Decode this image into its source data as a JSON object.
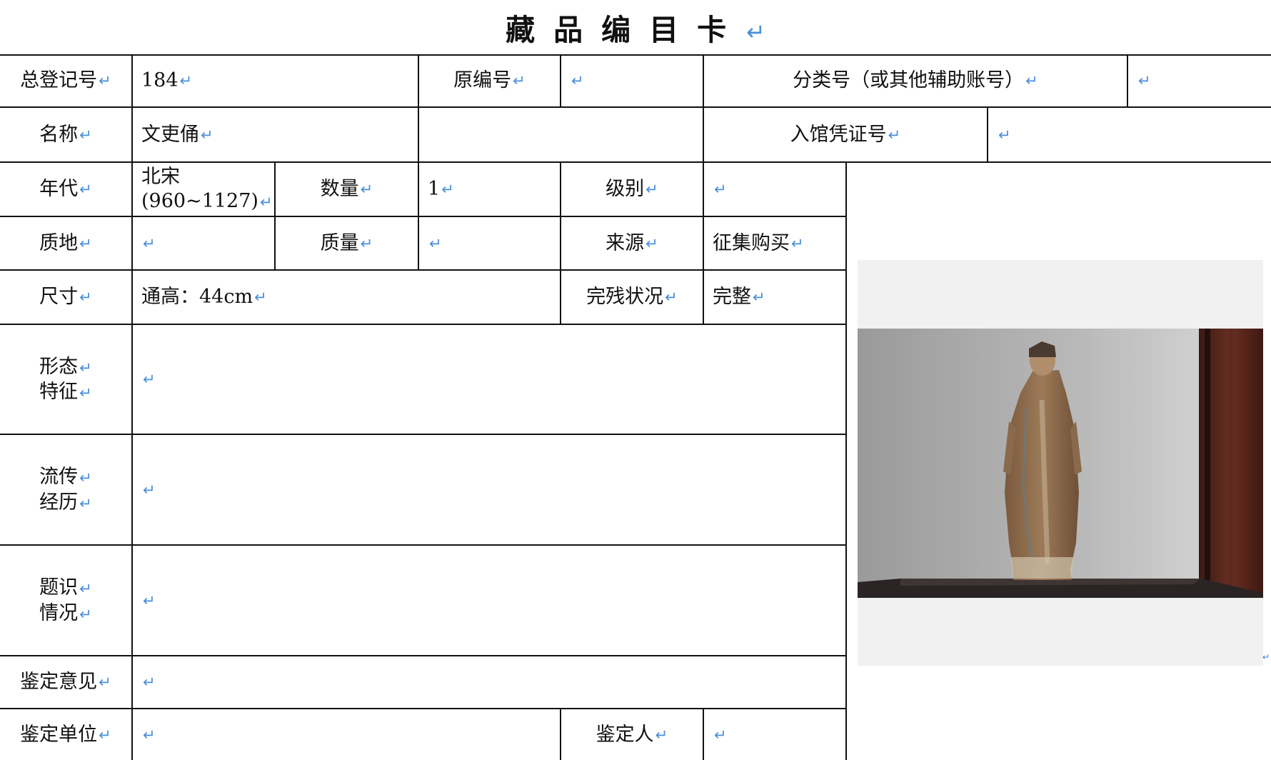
{
  "title": "藏品编目卡",
  "para_mark": "↵",
  "fields": {
    "total_reg_no": {
      "label": "总登记号",
      "value": "184"
    },
    "original_no": {
      "label": "原编号",
      "value": ""
    },
    "classification_no": {
      "label": "分类号（或其他辅助账号）",
      "value": ""
    },
    "name": {
      "label": "名称",
      "value": "文吏俑"
    },
    "entry_voucher_no": {
      "label": "入馆凭证号",
      "value": ""
    },
    "era": {
      "label": "年代",
      "value_line1": "北宋",
      "value_line2": "(960~1127)"
    },
    "quantity": {
      "label": "数量",
      "value": "1"
    },
    "grade": {
      "label": "级别",
      "value": ""
    },
    "material": {
      "label": "质地",
      "value": ""
    },
    "mass": {
      "label": "质量",
      "value": ""
    },
    "source": {
      "label": "来源",
      "value": "征集购买"
    },
    "dimensions": {
      "label": "尺寸",
      "value": "通高：44cm"
    },
    "condition": {
      "label": "完残状况",
      "value": "完整"
    },
    "morphology": {
      "label_line1": "形态",
      "label_line2": "特征",
      "value": ""
    },
    "provenance": {
      "label_line1": "流传",
      "label_line2": "经历",
      "value": ""
    },
    "inscriptions": {
      "label_line1": "题识",
      "label_line2": "情况",
      "value": ""
    },
    "appraisal_opinion": {
      "label": "鉴定意见",
      "value": ""
    },
    "appraisal_unit": {
      "label": "鉴定单位",
      "value": ""
    },
    "appraiser": {
      "label": "鉴定人",
      "value": ""
    }
  },
  "colors": {
    "para_mark": "#4a8fd8",
    "grid": "#111111",
    "photo_frame": "#f1f1f1"
  }
}
